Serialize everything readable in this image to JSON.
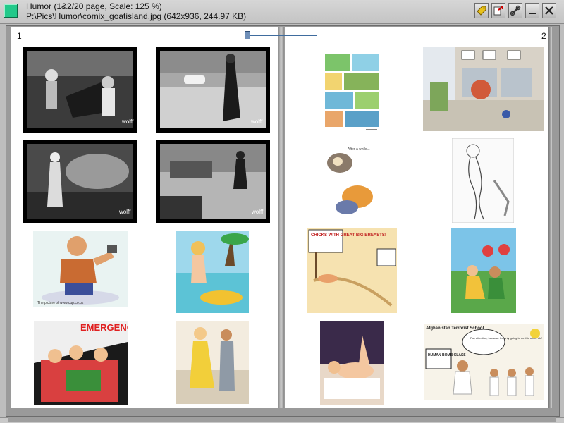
{
  "window": {
    "title_line1": "Humor (1&2/20 page, Scale: 125 %)",
    "title_line2": "P:\\Pics\\Humor\\comix_goatisland.jpg (642x936, 244.97 KB)",
    "icon": "app-icon",
    "controls": [
      "tag-icon",
      "export-icon",
      "tools-icon",
      "minimize-icon",
      "close-icon"
    ]
  },
  "pages": {
    "left_number": "1",
    "right_number": "2",
    "slider_position": 0.02
  },
  "thumbnails": {
    "left": [
      {
        "text": "wolff"
      },
      {
        "text": "wolff"
      },
      {
        "text": "wolff"
      },
      {
        "text": "wolff"
      },
      {
        "text": "The picture of www.cup.co.uk"
      },
      {
        "text": ""
      },
      {
        "text": "EMERGENCY"
      },
      {
        "text": ""
      }
    ],
    "right": [
      {
        "text": ""
      },
      {
        "text": ""
      },
      {
        "text": "After a while..."
      },
      {
        "text": ""
      },
      {
        "text": "CHICKS WITH GREAT BIG BREASTS!"
      },
      {
        "text": ""
      },
      {
        "text": ""
      },
      {
        "text": "Afghanistan Terrorist School"
      },
      {
        "sign": "HUMAN BOMB CLASS"
      },
      {
        "bubble": "Pay attention, because I'm only going to do this once, ok?"
      }
    ]
  },
  "colors": {
    "accent": "#22c98a",
    "slider": "#3f6c9e"
  }
}
